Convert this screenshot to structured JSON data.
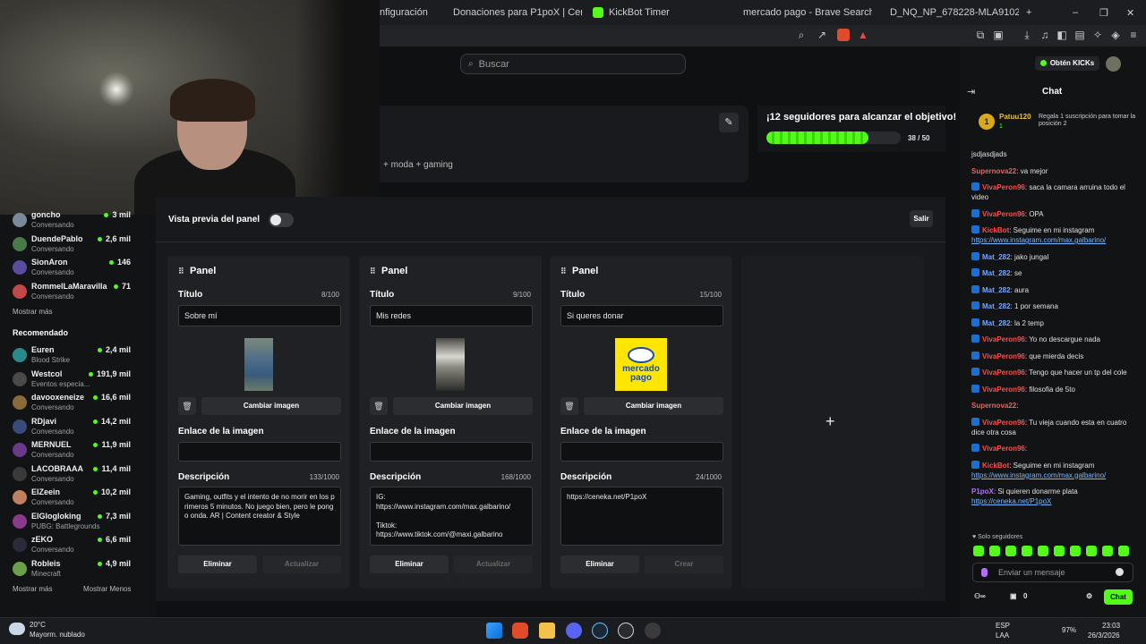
{
  "browser": {
    "tabs": [
      {
        "label": "nfiguración"
      },
      {
        "label": "Donaciones para P1poX | Ceneka"
      },
      {
        "label": "KickBot Timer"
      },
      {
        "label": "mercado pago - Brave Search"
      },
      {
        "label": "D_NQ_NP_678228-MLA9102786251..."
      }
    ],
    "new_tab": "+",
    "window_controls": [
      "–",
      "❐",
      "✕"
    ]
  },
  "header": {
    "search_placeholder": "Buscar"
  },
  "profile": {
    "tags": "+ moda + gaming",
    "goal_title": "¡12 seguidores para alcanzar el objetivo!",
    "goal_count": "38 / 50",
    "goal_progress": 0.76
  },
  "sidebar": {
    "following": [
      {
        "name": "goncho",
        "category": "Conversando",
        "viewers": "3 mil",
        "color": "#7a8a9a"
      },
      {
        "name": "DuendePablo",
        "category": "Conversando",
        "viewers": "2,6 mil",
        "color": "#4a7a4a"
      },
      {
        "name": "SionAron",
        "category": "Conversando",
        "viewers": "146",
        "color": "#5a4aa0"
      },
      {
        "name": "RommelLaMaravilla",
        "category": "Conversando",
        "viewers": "71",
        "color": "#c04848"
      }
    ],
    "show_more": "Mostrar más",
    "recommended_title": "Recomendado",
    "recommended": [
      {
        "name": "Euren",
        "category": "Blood Strike",
        "viewers": "2,4 mil",
        "color": "#2a8a8a"
      },
      {
        "name": "Westcol",
        "category": "Eventos especia...",
        "viewers": "191,9 mil",
        "color": "#4a4a4a"
      },
      {
        "name": "davooxeneize",
        "category": "Conversando",
        "viewers": "16,6 mil",
        "color": "#8a6a3a"
      },
      {
        "name": "RDjavi",
        "category": "Conversando",
        "viewers": "14,2 mil",
        "color": "#3a4a7a"
      },
      {
        "name": "MERNUEL",
        "category": "Conversando",
        "viewers": "11,9 mil",
        "color": "#6a3a8a"
      },
      {
        "name": "LACOBRAAA",
        "category": "Conversando",
        "viewers": "11,4 mil",
        "color": "#3a3a3a"
      },
      {
        "name": "ElZeein",
        "category": "Conversando",
        "viewers": "10,2 mil",
        "color": "#c08060"
      },
      {
        "name": "ElGlogloking",
        "category": "PUBG: Battlegrounds",
        "viewers": "7,3 mil",
        "color": "#8a3a8a"
      },
      {
        "name": "zEKO",
        "category": "Conversando",
        "viewers": "6,6 mil",
        "color": "#2a2a3a"
      },
      {
        "name": "Robleis",
        "category": "Minecraft",
        "viewers": "4,9 mil",
        "color": "#6aa04a"
      }
    ],
    "show_more_2": "Mostrar más",
    "show_less": "Mostrar Menos"
  },
  "editor": {
    "title": "Vista previa del panel",
    "exit_label": "Salir",
    "panels": [
      {
        "header": "Panel",
        "title_label": "Título",
        "title_count": "8/100",
        "title_value": "Sobre mí",
        "change_image": "Cambiar imagen",
        "link_label": "Enlace de la imagen",
        "link_value": "",
        "desc_label": "Descripción",
        "desc_count": "133/1000",
        "desc_value": "Gaming, outfits y el intento de no morir en los primeros 5 minutos. No juego bien, pero le pongo onda. AR | Content creator & Style",
        "delete_label": "Eliminar",
        "action_label": "Actualizar",
        "image_kind": "photo-outfit"
      },
      {
        "header": "Panel",
        "title_label": "Título",
        "title_count": "9/100",
        "title_value": "Mis redes",
        "change_image": "Cambiar imagen",
        "link_label": "Enlace de la imagen",
        "link_value": "",
        "desc_label": "Descripción",
        "desc_count": "168/1000",
        "desc_value": "IG:\nhttps://www.instagram.com/max.galbarino/\n\nTiktok:\nhttps://www.tiktok.com/@maxi.galbarino",
        "delete_label": "Eliminar",
        "action_label": "Actualizar",
        "image_kind": "photo-street"
      },
      {
        "header": "Panel",
        "title_label": "Título",
        "title_count": "15/100",
        "title_value": "Si queres donar",
        "change_image": "Cambiar imagen",
        "link_label": "Enlace de la imagen",
        "link_value": "",
        "desc_label": "Descripción",
        "desc_count": "24/1000",
        "desc_value": "https://ceneka.net/P1poX",
        "delete_label": "Eliminar",
        "action_label": "Crear",
        "image_kind": "mercado-pago-logo",
        "logo_line1": "mercado",
        "logo_line2": "pago"
      }
    ],
    "add_icon": "+"
  },
  "chat": {
    "get_kicks": "Obtén KICKs",
    "title": "Chat",
    "top_gifter": {
      "rank": "1",
      "name": "Patuu120",
      "count": "1",
      "note": "Regala 1 suscripción para tomar la posición 2"
    },
    "messages": [
      {
        "user": "",
        "color": "#e0e0e0",
        "text": "jsdjasdjads",
        "badge": false
      },
      {
        "user": "Supernova22",
        "color": "#e06666",
        "text": ": va mejor",
        "badge": false
      },
      {
        "user": "VivaPeron96",
        "color": "#ff4d4d",
        "text": ": saca la camara arruina todo el video",
        "badge": true
      },
      {
        "user": "VivaPeron96",
        "color": "#ff4d4d",
        "text": ": OPA",
        "badge": true
      },
      {
        "user": "KickBot",
        "color": "#ff4d4d",
        "text": ": Seguime en mi instagram ",
        "link": "https://www.instagram.com/max.galbarino/",
        "badge": true
      },
      {
        "user": "Mat_282",
        "color": "#7aa7ff",
        "text": ": jako jungal",
        "badge": true
      },
      {
        "user": "Mat_282",
        "color": "#7aa7ff",
        "text": ": se",
        "badge": true
      },
      {
        "user": "Mat_282",
        "color": "#7aa7ff",
        "text": ": aura",
        "badge": true
      },
      {
        "user": "Mat_282",
        "color": "#7aa7ff",
        "text": ": 1 por semana",
        "badge": true
      },
      {
        "user": "Mat_282",
        "color": "#7aa7ff",
        "text": ": la 2 temp",
        "badge": true
      },
      {
        "user": "VivaPeron96",
        "color": "#ff4d4d",
        "text": ": Yo no descargue nada",
        "badge": true
      },
      {
        "user": "VivaPeron96",
        "color": "#ff4d4d",
        "text": ": que mierda decis",
        "badge": true
      },
      {
        "user": "VivaPeron96",
        "color": "#ff4d4d",
        "text": ": Tengo que hacer un tp del cole",
        "badge": true
      },
      {
        "user": "VivaPeron96",
        "color": "#ff4d4d",
        "text": ": filosofia de 5to",
        "badge": true
      },
      {
        "user": "Supernova22",
        "color": "#e06666",
        "text": ":",
        "badge": false
      },
      {
        "user": "VivaPeron96",
        "color": "#ff4d4d",
        "text": ": Tu vieja cuando esta en cuatro dice otra cosa",
        "badge": true
      },
      {
        "user": "VivaPeron96",
        "color": "#ff4d4d",
        "text": ":",
        "badge": true
      },
      {
        "user": "KickBot",
        "color": "#ff4d4d",
        "text": ": Seguime en mi instagram ",
        "link": "https://www.instagram.com/max.galbarino/",
        "badge": true
      },
      {
        "user": "P1poX",
        "color": "#b66dff",
        "text": ": Si quieren donarme plata ",
        "link": "https://ceneka.net/P1poX",
        "badge": false
      }
    ],
    "followers_only": "Solo seguidores",
    "input_placeholder": "Enviar un mensaje",
    "send_label": "Chat",
    "footer_count_1": "0",
    "footer_count_2": "0"
  },
  "taskbar": {
    "temp": "20°C",
    "weather": "Mayorm. nublado",
    "lang_1": "ESP",
    "lang_2": "LAA",
    "battery": "97%",
    "time": "23:03",
    "date": "26/3/2026"
  }
}
